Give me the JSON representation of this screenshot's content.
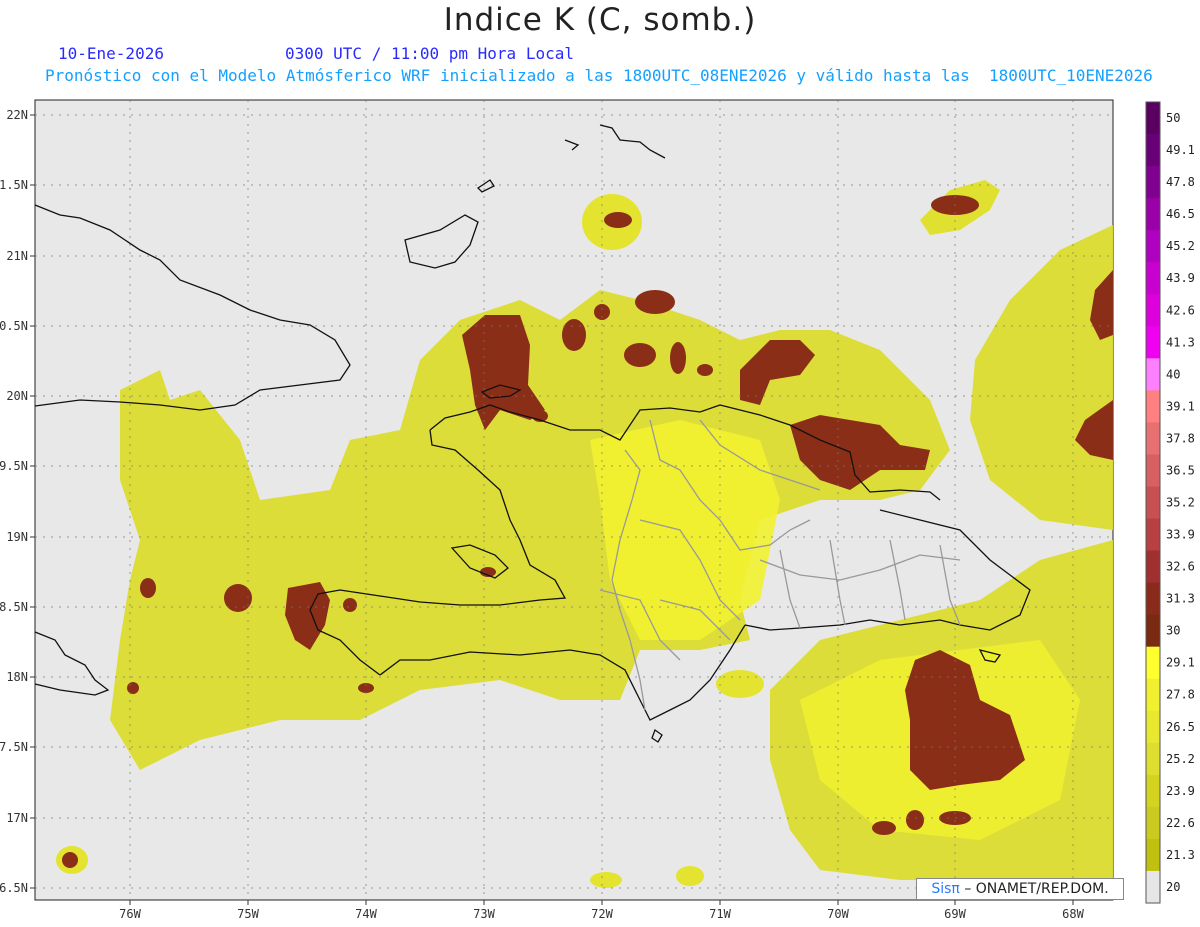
{
  "header": {
    "title": "Indice K (C, somb.)",
    "date": "10-Ene-2026",
    "time": "0300 UTC / 11:00 pm Hora Local",
    "model_line": "Pronóstico con el Modelo Atmósferico WRF inicializado a las 1800UTC_08ENE2026 y válido hasta las  1800UTC_10ENE2026"
  },
  "map": {
    "lat_labels": [
      "22N",
      "1.5N",
      "21N",
      "0.5N",
      "20N",
      "9.5N",
      "19N",
      "8.5N",
      "18N",
      "7.5N",
      "17N",
      "6.5N"
    ],
    "lon_labels": [
      "76W",
      "75W",
      "74W",
      "73W",
      "72W",
      "71W",
      "70W",
      "69W",
      "68W"
    ],
    "background_color": "#e8e8e8",
    "grid": "dotted"
  },
  "colorbar": {
    "labels": [
      "50",
      "49.1",
      "47.8",
      "46.5",
      "45.2",
      "43.9",
      "42.6",
      "41.3",
      "40",
      "39.1",
      "37.8",
      "36.5",
      "35.2",
      "33.9",
      "32.6",
      "31.3",
      "30",
      "29.1",
      "27.8",
      "26.5",
      "25.2",
      "23.9",
      "22.6",
      "21.3",
      "20"
    ],
    "colors": [
      "#5a0060",
      "#6a0078",
      "#800090",
      "#9a00a8",
      "#b000c0",
      "#c800d0",
      "#dd00dd",
      "#f000f0",
      "#ff80ff",
      "#ff8080",
      "#e87070",
      "#d86060",
      "#c85050",
      "#b84040",
      "#a03030",
      "#8a2a1a",
      "#7a2a10",
      "#ffff30",
      "#f0f030",
      "#e8e830",
      "#dede30",
      "#d4d420",
      "#caca20",
      "#c0c010",
      "#e6e6e6"
    ]
  },
  "footer": {
    "brand": "Sisπ",
    "org": "– ONAMET/REP.DOM."
  }
}
